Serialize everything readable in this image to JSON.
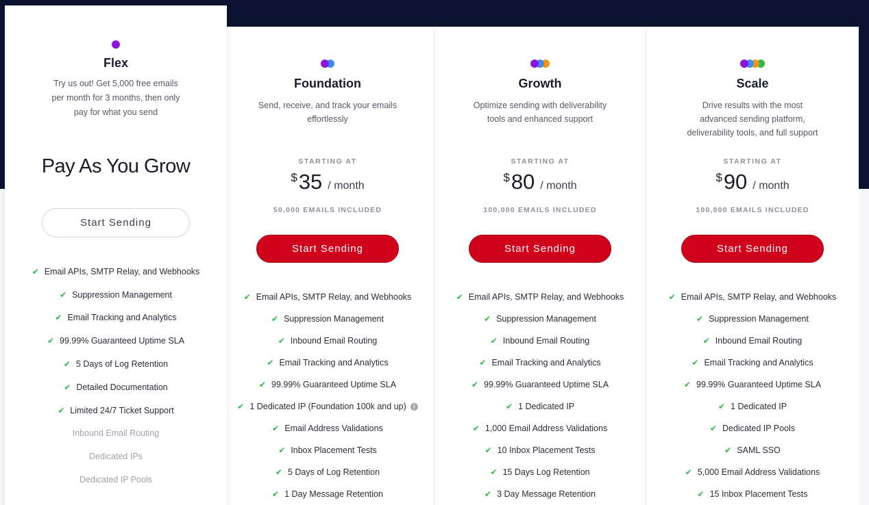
{
  "flex": {
    "name": "Flex",
    "description_lines": [
      "Try us out! Get 5,000 free emails",
      "per month for 3 months, then only",
      "pay for what you send"
    ],
    "hero": "Pay As You Grow",
    "button_label": "Start Sending",
    "dot_colors": [
      "#8a13e0"
    ],
    "features": [
      {
        "label": "Email APIs, SMTP Relay, and Webhooks",
        "included": true
      },
      {
        "label": "Suppression Management",
        "included": true
      },
      {
        "label": "Email Tracking and Analytics",
        "included": true
      },
      {
        "label": "99.99% Guaranteed Uptime SLA",
        "included": true
      },
      {
        "label": "5 Days of Log Retention",
        "included": true
      },
      {
        "label": "Detailed Documentation",
        "included": true
      },
      {
        "label": "Limited 24/7 Ticket Support",
        "included": true
      },
      {
        "label": "Inbound Email Routing",
        "included": false
      },
      {
        "label": "Dedicated IPs",
        "included": false
      },
      {
        "label": "Dedicated IP Pools",
        "included": false
      }
    ]
  },
  "plans": [
    {
      "name": "Foundation",
      "description_lines": [
        "Send, receive, and track your emails",
        "effortlessly"
      ],
      "starting_label": "STARTING AT",
      "currency": "$",
      "price": "35",
      "period": "/ month",
      "included": "50,000 EMAILS INCLUDED",
      "button_label": "Start Sending",
      "dot_colors": [
        "#8a13e0",
        "#3d8cf5"
      ],
      "features": [
        "Email APIs, SMTP Relay, and Webhooks",
        "Suppression Management",
        "Inbound Email Routing",
        "Email Tracking and Analytics",
        "99.99% Guaranteed Uptime SLA",
        "1 Dedicated IP (Foundation 100k and up)",
        "Email Address Validations",
        "Inbox Placement Tests",
        "5 Days of Log Retention",
        "1 Day Message Retention"
      ]
    },
    {
      "name": "Growth",
      "description_lines": [
        "Optimize sending with deliverability",
        "tools and enhanced support"
      ],
      "starting_label": "STARTING AT",
      "currency": "$",
      "price": "80",
      "period": "/ month",
      "included": "100,000 EMAILS INCLUDED",
      "button_label": "Start Sending",
      "dot_colors": [
        "#8a13e0",
        "#3d8cf5",
        "#f2960f"
      ],
      "features": [
        "Email APIs, SMTP Relay, and Webhooks",
        "Suppression Management",
        "Inbound Email Routing",
        "Email Tracking and Analytics",
        "99.99% Guaranteed Uptime SLA",
        "1 Dedicated IP",
        "1,000 Email Address Validations",
        "10 Inbox Placement Tests",
        "15 Days Log Retention",
        "3 Day Message Retention"
      ]
    },
    {
      "name": "Scale",
      "description_lines": [
        "Drive results with the most",
        "advanced sending platform,",
        "deliverability tools, and full support"
      ],
      "starting_label": "STARTING AT",
      "currency": "$",
      "price": "90",
      "period": "/ month",
      "included": "100,000 EMAILS INCLUDED",
      "button_label": "Start Sending",
      "dot_colors": [
        "#8a13e0",
        "#3d8cf5",
        "#f2960f",
        "#2fb84a"
      ],
      "features": [
        "Email APIs, SMTP Relay, and Webhooks",
        "Suppression Management",
        "Inbound Email Routing",
        "Email Tracking and Analytics",
        "99.99% Guaranteed Uptime SLA",
        "1 Dedicated IP",
        "Dedicated IP Pools",
        "SAML SSO",
        "5,000 Email Address Validations",
        "15 Inbox Placement Tests"
      ]
    }
  ]
}
